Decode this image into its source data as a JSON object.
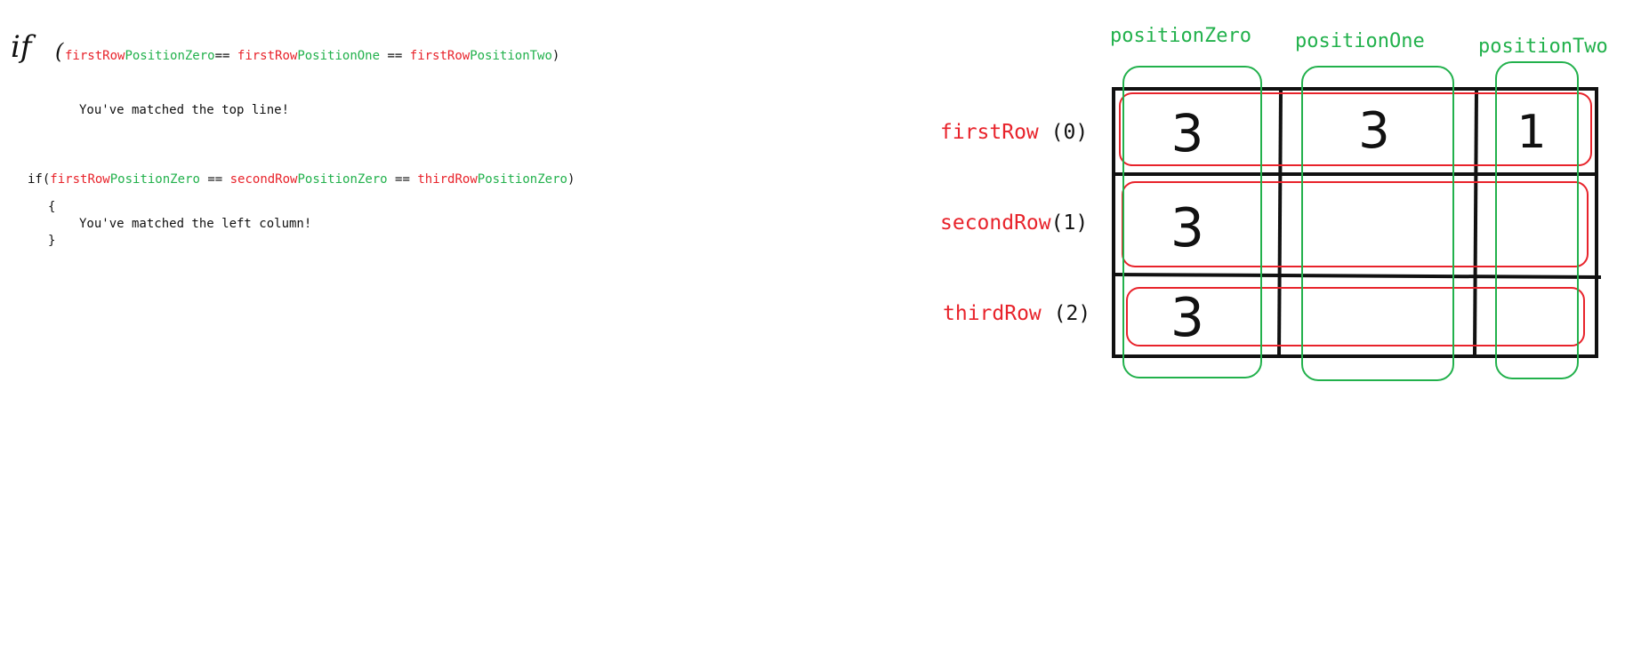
{
  "code": {
    "if1": {
      "keyword": "if",
      "open_paren": "(",
      "a_row": "firstRow",
      "a_pos": "PositionZero",
      "eq1": "== ",
      "b_row": "firstRow",
      "b_pos": "PositionOne",
      "eq2": " == ",
      "c_row": "firstRow",
      "c_pos": "PositionTwo",
      "close_paren": ")",
      "message": "You've matched the top line!"
    },
    "if2": {
      "prefix": "if(",
      "a_row": "firstRow",
      "a_pos": "PositionZero",
      "eq1": " == ",
      "b_row": "secondRow",
      "b_pos": "PositionZero",
      "eq2": " == ",
      "c_row": "thirdRow",
      "c_pos": "PositionZero",
      "close_paren": ")",
      "open_brace": "{",
      "message": "You've matched the left column!",
      "close_brace": "}"
    }
  },
  "grid": {
    "columns": [
      "positionZero",
      "positionOne",
      "positionTwo"
    ],
    "rows": [
      {
        "name": "firstRow",
        "index": "(0)"
      },
      {
        "name": "secondRow",
        "index": "(1)"
      },
      {
        "name": "thirdRow",
        "index": "(2)"
      }
    ],
    "cells": [
      [
        "3",
        "3",
        "1"
      ],
      [
        "3",
        "",
        ""
      ],
      [
        "3",
        "",
        ""
      ]
    ]
  },
  "colors": {
    "row_highlight": "#e8232b",
    "column_highlight": "#22b14c",
    "ink": "#111111"
  }
}
